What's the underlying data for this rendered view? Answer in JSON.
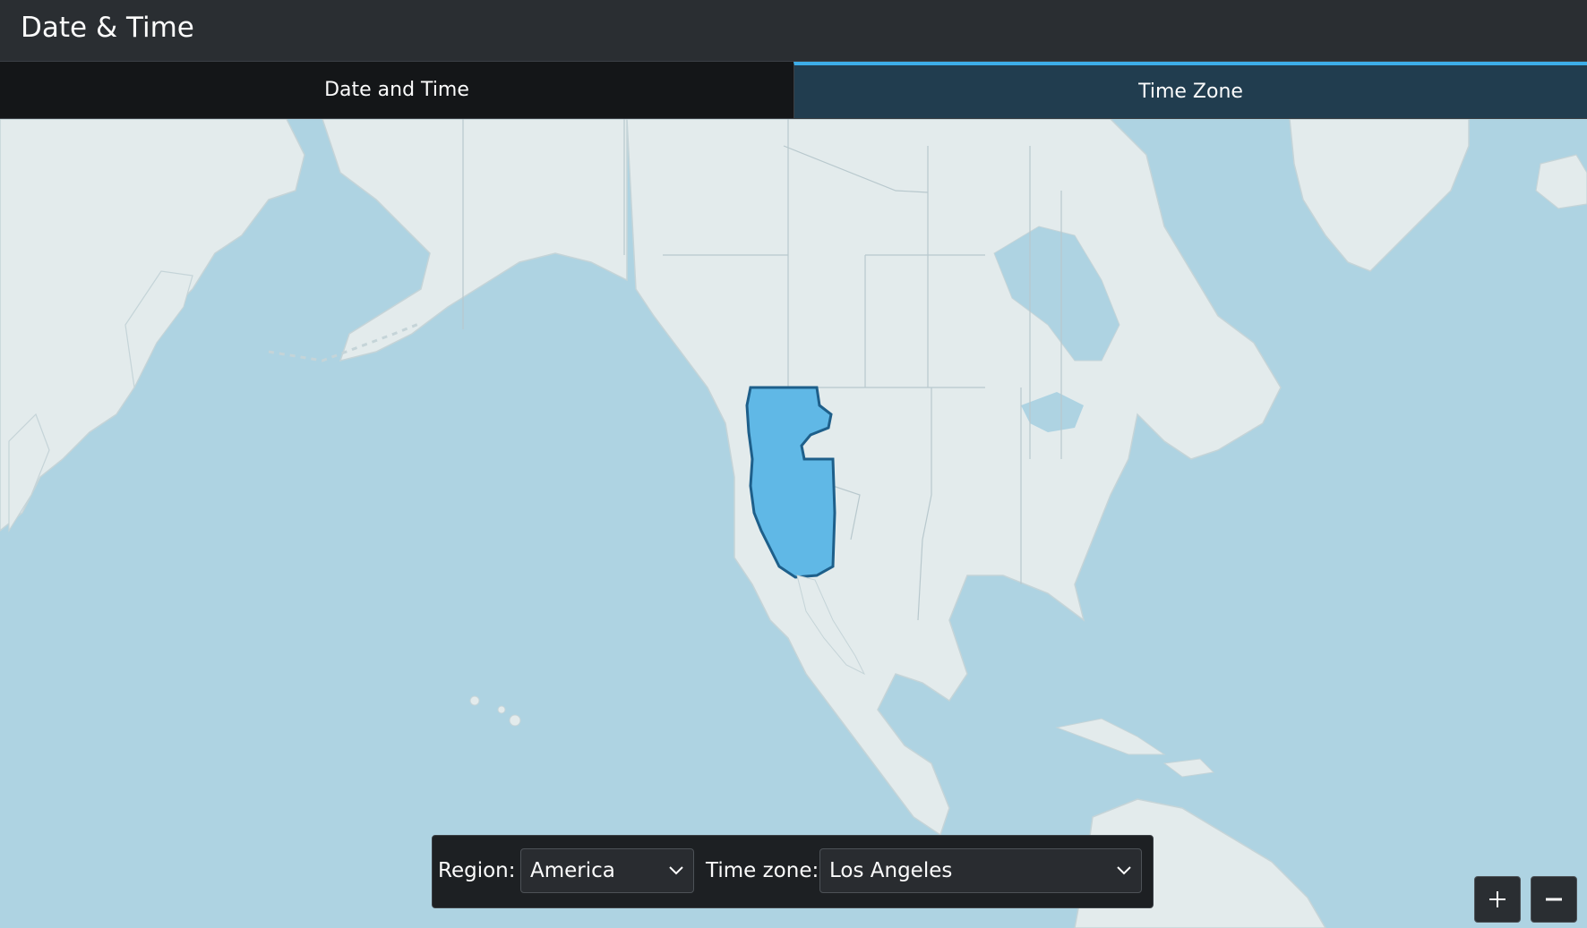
{
  "window": {
    "title": "Date & Time"
  },
  "tabs": [
    {
      "label": "Date and Time",
      "active": false
    },
    {
      "label": "Time Zone",
      "active": true
    }
  ],
  "selector": {
    "region_label": "Region:",
    "region_value": "America",
    "timezone_label": "Time zone:",
    "timezone_value": "Los Angeles"
  },
  "zoom": {
    "in_icon": "plus-icon",
    "out_icon": "minus-icon"
  },
  "colors": {
    "accent": "#3daee9",
    "ocean": "#aed3e2",
    "land": "#e3ebec",
    "highlight": "#60b8e6"
  }
}
